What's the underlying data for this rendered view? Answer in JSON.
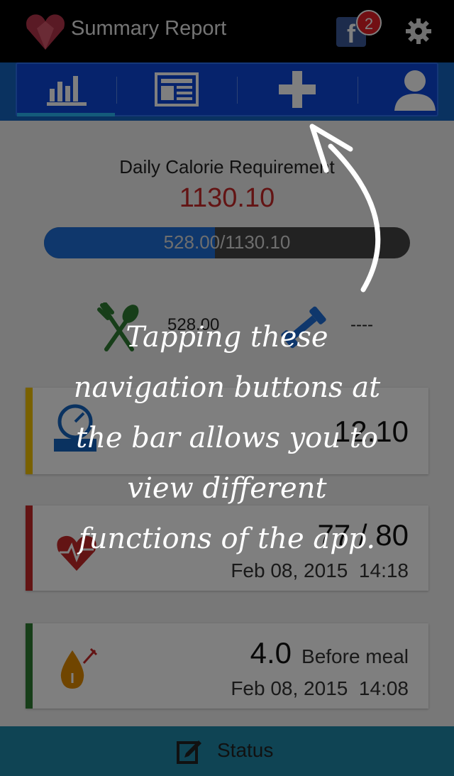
{
  "appbar": {
    "title": "Summary Report",
    "notification_count": "2",
    "fb_letter": "f"
  },
  "tabs": [
    {
      "icon": "bar-chart-icon"
    },
    {
      "icon": "newspaper-icon"
    },
    {
      "icon": "plus-icon"
    },
    {
      "icon": "user-icon"
    }
  ],
  "summary": {
    "title": "Daily Calorie Requirement",
    "requirement": "1130.10",
    "progress_text": "528.00/1130.10",
    "progress_fraction": 0.467,
    "food_value": "528.00",
    "exercise_value": "----"
  },
  "cards": {
    "bmi": {
      "value": "12.10"
    },
    "heart": {
      "value": "77 / 80",
      "date": "Feb 08, 2015",
      "time": "14:18"
    },
    "glucose": {
      "value": "4.0",
      "note": "Before meal",
      "date": "Feb 08, 2015",
      "time": "14:08"
    }
  },
  "bottombar": {
    "label": "Status"
  },
  "tooltip": {
    "lines": [
      "Tapping these",
      "navigation buttons at",
      "the bar allows you to",
      "view different",
      "functions of the app."
    ]
  },
  "colors": {
    "accent": "#1565c0",
    "bmi": "#f2c200",
    "heart": "#c62828",
    "glucose": "#2e7d32",
    "status_bar": "#1e88a8"
  }
}
